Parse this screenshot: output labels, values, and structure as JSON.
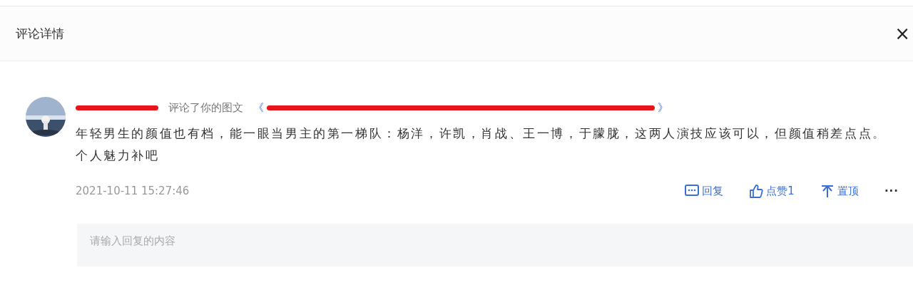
{
  "dialog": {
    "title": "评论详情",
    "close": "×"
  },
  "comment": {
    "action": "评论了你的图文",
    "title_open": "《",
    "title_close": "》",
    "text": "年轻男生的颜值也有档，能一眼当男主的第一梯队：杨洋，许凯，肖战、王一博，于朦胧，这两人演技应该可以，但颜值稍差点点。个人魅力补吧",
    "time": "2021-10-11 15:27:46",
    "actions": [
      {
        "kind": "reply",
        "label": "回复"
      },
      {
        "kind": "like",
        "label": "点赞1"
      },
      {
        "kind": "pin",
        "label": "置顶"
      },
      {
        "kind": "more",
        "label": "···"
      }
    ]
  },
  "reply_box": {
    "placeholder": "请输入回复的内容"
  }
}
